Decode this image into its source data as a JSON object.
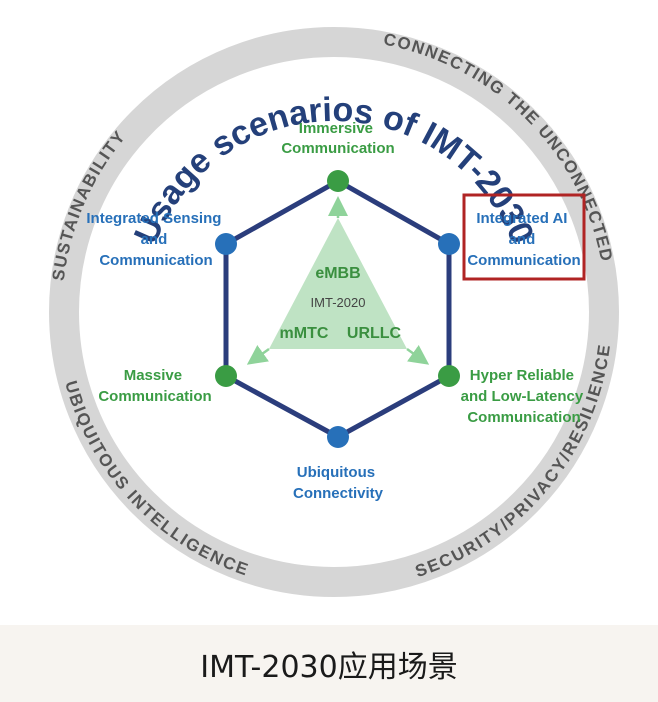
{
  "title": "Usage scenarios of IMT-2030",
  "ring_labels": {
    "sustainability": "SUSTAINABILITY",
    "connecting": "CONNECTING THE UNCONNECTED",
    "ubiquitous_intelligence": "UBIQUITOUS INTELLIGENCE",
    "security": "SECURITY/PRIVACY/RESILIENCE"
  },
  "scenarios": {
    "immersive": [
      "Immersive",
      "Communication"
    ],
    "sensing": [
      "Integrated Sensing",
      "and",
      "Communication"
    ],
    "ai": [
      "Integrated AI",
      "and",
      "Communication"
    ],
    "massive": [
      "Massive",
      "Communication"
    ],
    "hrllc": [
      "Hyper Reliable",
      "and Low-Latency",
      "Communication"
    ],
    "ubiquitous": [
      "Ubiquitous",
      "Connectivity"
    ]
  },
  "triangle": {
    "top": "eMBB",
    "center": "IMT-2020",
    "left": "mMTC",
    "right": "URLLC"
  },
  "caption": "IMT-2030应用场景",
  "colors": {
    "blue_node": "#2770b9",
    "green_node": "#3a9c44",
    "hexagon": "#2b3d7c",
    "ring": "#d6d6d6",
    "highlight_box": "#b02424",
    "triangle": "#bfe3c4"
  }
}
